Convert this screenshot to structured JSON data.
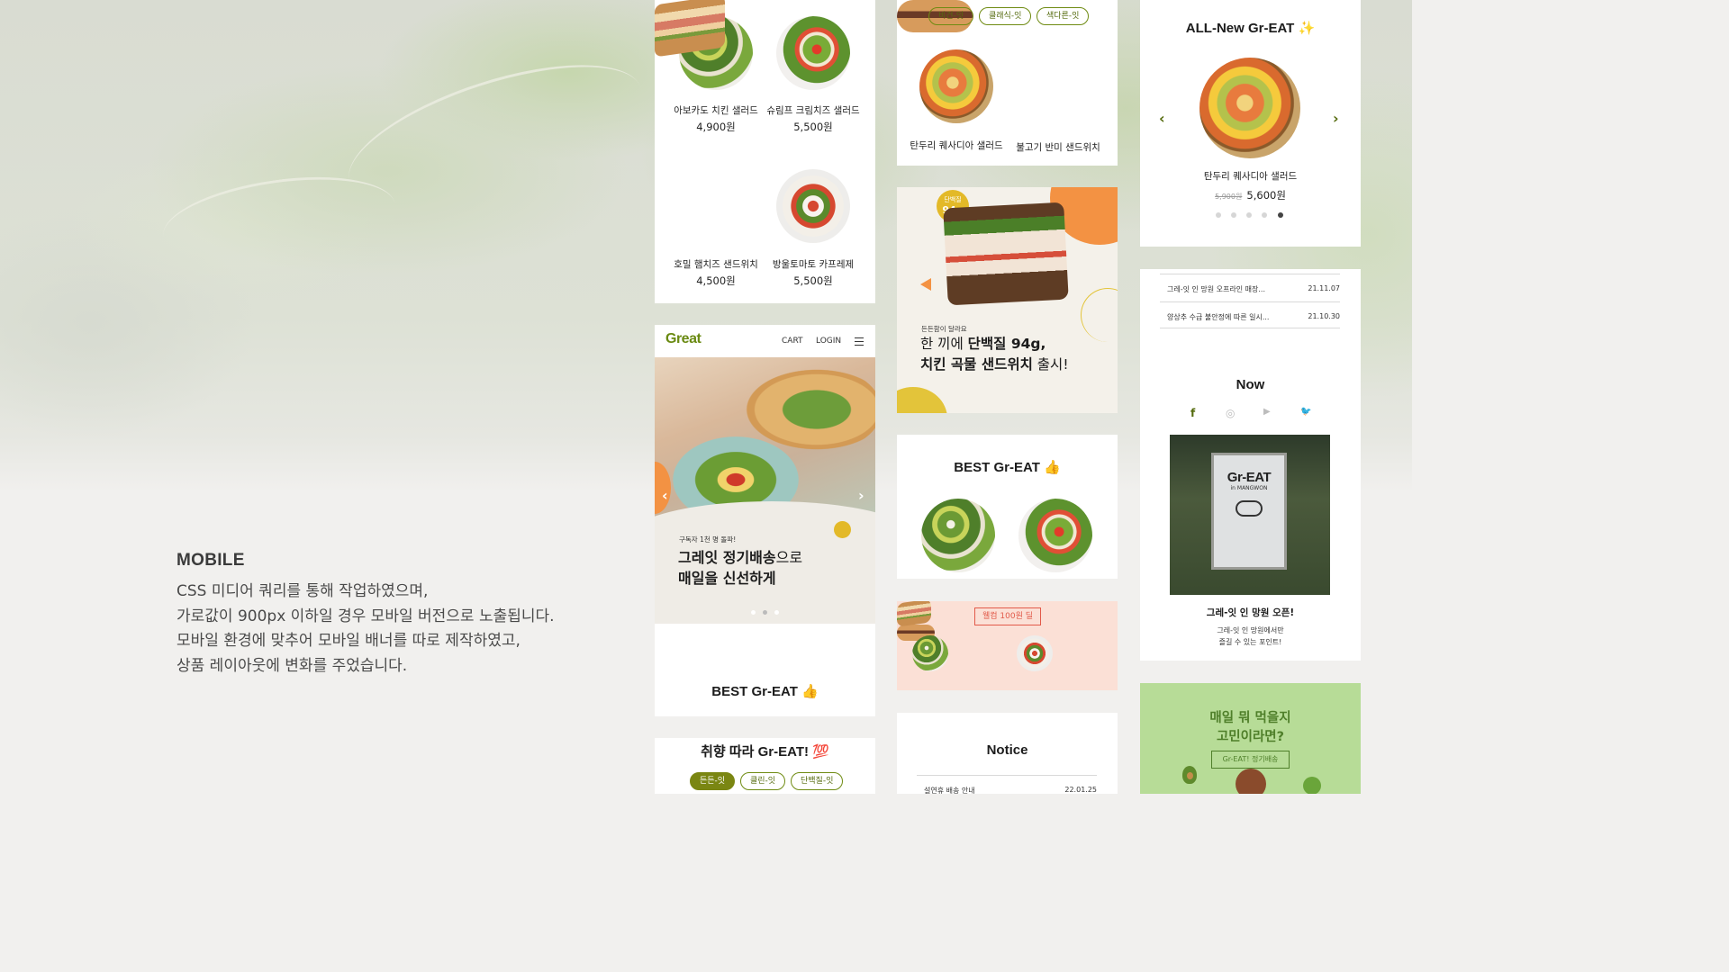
{
  "intro": {
    "heading": "MOBILE",
    "lines": [
      "CSS 미디어 쿼리를 통해 작업하였으며,",
      "가로값이 900px 이하일 경우 모바일 버전으로 노출됩니다.",
      "모바일 환경에 맞추어 모바일 배너를 따로 제작하였고,",
      "상품 레이아웃에 변화를 주었습니다."
    ]
  },
  "col1": {
    "products": [
      {
        "name": "아보카도 치킨 샐러드",
        "price": "4,900원"
      },
      {
        "name": "슈림프 크림치즈 샐러드",
        "price": "5,500원"
      },
      {
        "name": "호밀 햄치즈 샌드위치",
        "price": "4,500원"
      },
      {
        "name": "방울토마토 카프레제",
        "price": "5,500원"
      }
    ],
    "header": {
      "logo": "Great",
      "cart": "CART",
      "login": "LOGIN"
    },
    "banner": {
      "kicker": "구독자 1천 명 돌파!",
      "line1_bold": "그레잇 정기배송",
      "line1_rest": "으로",
      "line2": "매일을 신선하게",
      "prev": "‹",
      "next": "›"
    },
    "best_title": "BEST Gr-EAT 👍",
    "taste_title": "취향 따라 Gr-EAT! 💯",
    "taste_chips": [
      "든든-잇",
      "클린-잇",
      "단백질-잇"
    ]
  },
  "col2": {
    "chips": [
      "비건-잇",
      "클래식-잇",
      "색다른-잇"
    ],
    "products": [
      {
        "name": "탄두리 퀘사디아 샐러드"
      },
      {
        "name": "불고기 반미 샌드위치"
      }
    ],
    "promo": {
      "badge_top": "단백질",
      "badge_value": "94g",
      "kicker": "든든함이 달라요",
      "line1_pre": "한 끼에 ",
      "line1_bold": "단백질 94g,",
      "line2_bold": "치킨 곡물 샌드위치",
      "line2_rest": " 출시!"
    },
    "best_title": "BEST Gr-EAT 👍",
    "deal_label": "웰컴 100원 딜",
    "notice_title": "Notice",
    "notice_first": {
      "title": "설연휴 배송 안내",
      "date": "22.01.25"
    }
  },
  "col3": {
    "new_title": "ALL-New Gr-EAT ✨",
    "new_item": {
      "name": "탄두리 퀘사디아 샐러드",
      "old_price": "5,900원",
      "price": "5,600원"
    },
    "prev": "‹",
    "next": "›",
    "notices": [
      {
        "title": "그레-잇 인 망원 오프라인 매장...",
        "date": "21.11.07"
      },
      {
        "title": "양상추 수급 불안정에 따른 일시...",
        "date": "21.10.30"
      }
    ],
    "now_title": "Now",
    "sns": [
      "f",
      "◎",
      "▶",
      "🐦"
    ],
    "poster_text": "Gr-EAT",
    "poster_sub": "in MANGWON",
    "now_caption": "그레-잇 인 망원 오픈!",
    "now_desc1": "그레-잇 인 망원에서만",
    "now_desc2": "즐길 수 있는 포인트!",
    "subscribe_q1": "매일 뭐 먹을지",
    "subscribe_q2": "고민이라면?",
    "subscribe_btn": "Gr-EAT! 정기배송"
  },
  "colors": {
    "brand_green": "#6a8a12",
    "accent_orange": "#f39243",
    "accent_yellow": "#e3b928",
    "promo_pink": "#fbe0d6",
    "subscribe_green": "#b7dc97"
  }
}
